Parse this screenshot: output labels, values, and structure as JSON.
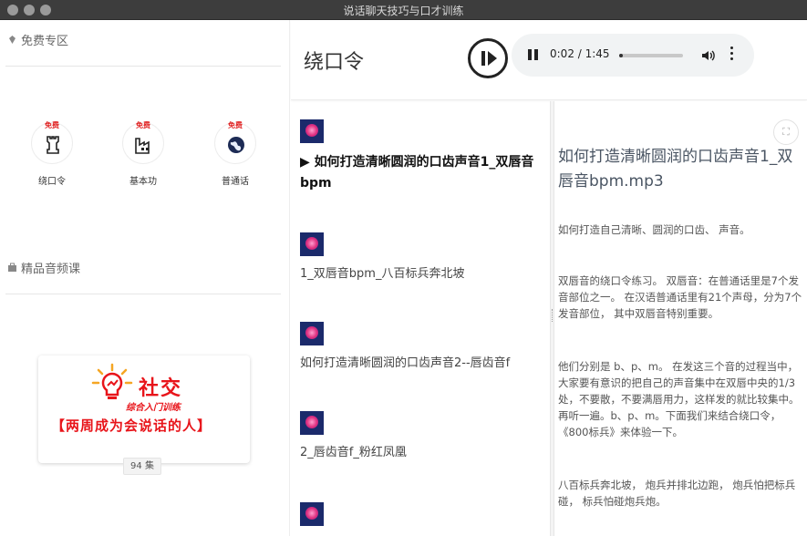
{
  "window": {
    "title": "说话聊天技巧与口才训练"
  },
  "sidebar": {
    "free_section": "免费专区",
    "free_items": [
      {
        "badge": "免费",
        "label": "绕口令",
        "icon": "chess-rook-icon"
      },
      {
        "badge": "免费",
        "label": "基本功",
        "icon": "factory-icon"
      },
      {
        "badge": "免费",
        "label": "普通话",
        "icon": "globe-icon"
      }
    ],
    "premium_section": "精品音频课",
    "banner": {
      "line1": "社交",
      "line2": "综合入门训练",
      "line3": "【两周成为会说话的人】"
    },
    "episode_count": "94 集"
  },
  "header": {
    "page_title": "绕口令",
    "player": {
      "time": "0:02 / 1:45",
      "progress": 0.02
    }
  },
  "list": {
    "items": [
      {
        "text": "▶ 如何打造清晰圆润的口齿声音1_双唇音bpm",
        "active": true
      },
      {
        "text": "1_双唇音bpm_八百标兵奔北坡",
        "active": false
      },
      {
        "text": "如何打造清晰圆润的口齿声音2--唇齿音f",
        "active": false
      },
      {
        "text": "2_唇齿音f_粉红凤凰",
        "active": false
      },
      {
        "text": "",
        "active": false
      }
    ]
  },
  "detail": {
    "title": "如何打造清晰圆润的口齿声音1_双唇音bpm.mp3",
    "paragraphs": [
      "如何打造自己清晰、圆润的口齿、 声音。",
      "双唇音的绕口令练习。 双唇音：在普通话里是7个发音部位之一。 在汉语普通话里有21个声母，分为7个发音部位， 其中双唇音特别重要。",
      "他们分别是 b、p、m。 在发这三个音的过程当中， 大家要有意识的把自己的声音集中在双唇中央的1/3处，不要散，不要满唇用力，这样发的就比较集中。再听一遍。b、p、m。下面我们来结合绕口令，《800标兵》来体验一下。",
      "八百标兵奔北坡， 炮兵并排北边跑， 炮兵怕把标兵碰， 标兵怕碰炮兵炮。"
    ]
  }
}
